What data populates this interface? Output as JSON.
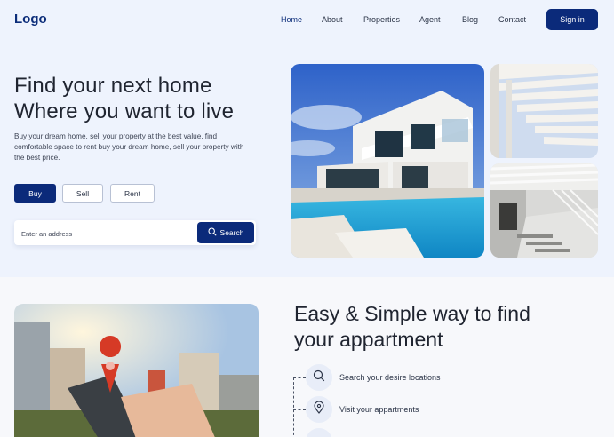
{
  "header": {
    "logo": "Logo",
    "nav": [
      "Home",
      "About",
      "Properties",
      "Agent",
      "Blog",
      "Contact"
    ],
    "signin_label": "Sign in"
  },
  "hero": {
    "title_line1": "Find your next home",
    "title_line2": "Where you want to live",
    "description": "Buy your dream home, sell your property at the best value, find comfortable space to rent buy your dream home, sell your property with the best price.",
    "tabs": [
      "Buy",
      "Sell",
      "Rent"
    ],
    "active_tab": "Buy",
    "search": {
      "placeholder": "Enter an address",
      "value": "",
      "button_label": "Search"
    }
  },
  "features": {
    "title_line1": "Easy & Simple way to find",
    "title_line2": "your appartment",
    "steps": [
      {
        "icon": "search-icon",
        "label": "Search your desire locations"
      },
      {
        "icon": "location-pin-icon",
        "label": "Visit your appartments"
      }
    ]
  },
  "colors": {
    "primary": "#0b2a7a",
    "hero_bg": "#eef3fd",
    "text": "#1f2430"
  }
}
